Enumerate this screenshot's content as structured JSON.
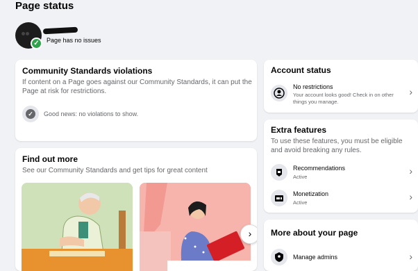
{
  "page": {
    "title": "Page status",
    "status_text": "Page has no issues"
  },
  "community_standards": {
    "title": "Community Standards violations",
    "description": "If content on a Page goes against our Community Standards, it can put the Page at risk for restrictions.",
    "good_news": "Good news: no violations to show."
  },
  "find_out_more": {
    "title": "Find out more",
    "description": "See our Community Standards and get tips for great content"
  },
  "account_status": {
    "title": "Account status",
    "row_label": "No restrictions",
    "row_sub": "Your account looks good! Check in on other things you manage."
  },
  "extra_features": {
    "title": "Extra features",
    "description": "To use these features, you must be eligible and avoid breaking any rules.",
    "items": [
      {
        "label": "Recommendations",
        "status": "Active"
      },
      {
        "label": "Monetization",
        "status": "Active"
      }
    ]
  },
  "more_about_page": {
    "title": "More about your page",
    "items": [
      {
        "label": "Manage admins"
      }
    ]
  },
  "colors": {
    "background": "#f0f2f5",
    "card": "#ffffff",
    "success": "#31a24c",
    "muted": "#65676b"
  }
}
